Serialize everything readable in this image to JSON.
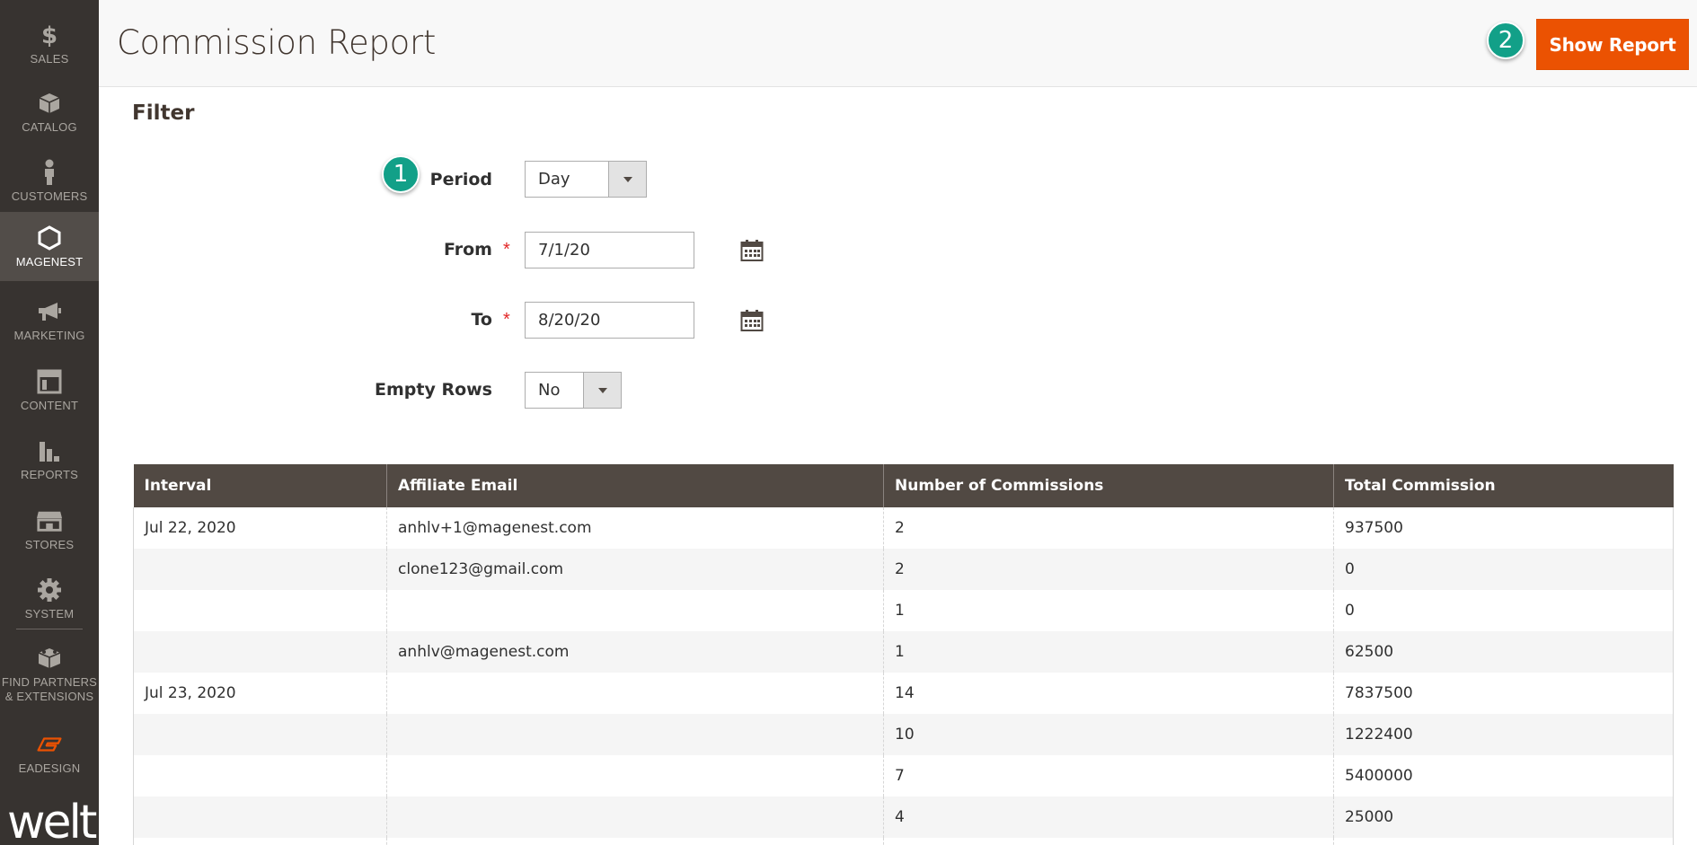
{
  "sidebar": {
    "items": [
      {
        "label": "SALES",
        "icon": "dollar-icon"
      },
      {
        "label": "CATALOG",
        "icon": "box-icon"
      },
      {
        "label": "CUSTOMERS",
        "icon": "person-icon"
      },
      {
        "label": "MAGENEST",
        "icon": "hexagon-icon",
        "active": true
      },
      {
        "label": "MARKETING",
        "icon": "megaphone-icon"
      },
      {
        "label": "CONTENT",
        "icon": "layout-icon"
      },
      {
        "label": "REPORTS",
        "icon": "bar-chart-icon"
      },
      {
        "label": "STORES",
        "icon": "storefront-icon"
      },
      {
        "label": "SYSTEM",
        "icon": "gear-icon"
      },
      {
        "label": "FIND PARTNERS & EXTENSIONS",
        "icon": "blocks-icon"
      },
      {
        "label": "EADESIGN",
        "icon": "eadesign-logo-icon"
      }
    ],
    "logo_text": "welt"
  },
  "header": {
    "title": "Commission Report",
    "show_report_label": "Show Report",
    "step_badge": "2"
  },
  "filter": {
    "heading": "Filter",
    "step_badge": "1",
    "period": {
      "label": "Period",
      "value": "Day"
    },
    "from": {
      "label": "From",
      "value": "7/1/20",
      "required_mark": "*"
    },
    "to": {
      "label": "To",
      "value": "8/20/20",
      "required_mark": "*"
    },
    "empty_rows": {
      "label": "Empty Rows",
      "value": "No"
    }
  },
  "table": {
    "columns": [
      "Interval",
      "Affiliate Email",
      "Number of Commissions",
      "Total Commission"
    ],
    "rows": [
      {
        "interval": "Jul 22, 2020",
        "email": "anhlv+1@magenest.com",
        "count": "2",
        "total": "937500"
      },
      {
        "interval": "",
        "email": "clone123@gmail.com",
        "count": "2",
        "total": "0"
      },
      {
        "interval": "",
        "email": "",
        "count": "1",
        "total": "0"
      },
      {
        "interval": "",
        "email": "anhlv@magenest.com",
        "count": "1",
        "total": "62500"
      },
      {
        "interval": "Jul 23, 2020",
        "email": "",
        "count": "14",
        "total": "7837500"
      },
      {
        "interval": "",
        "email": "",
        "count": "10",
        "total": "1222400"
      },
      {
        "interval": "",
        "email": "",
        "count": "7",
        "total": "5400000"
      },
      {
        "interval": "",
        "email": "",
        "count": "4",
        "total": "25000"
      },
      {
        "interval": "",
        "email": "",
        "count": "",
        "total": ""
      }
    ]
  },
  "colors": {
    "sidebar_bg": "#373330",
    "sidebar_active": "#524d49",
    "accent": "#eb5202",
    "badge": "#12a088",
    "table_header": "#514943"
  }
}
